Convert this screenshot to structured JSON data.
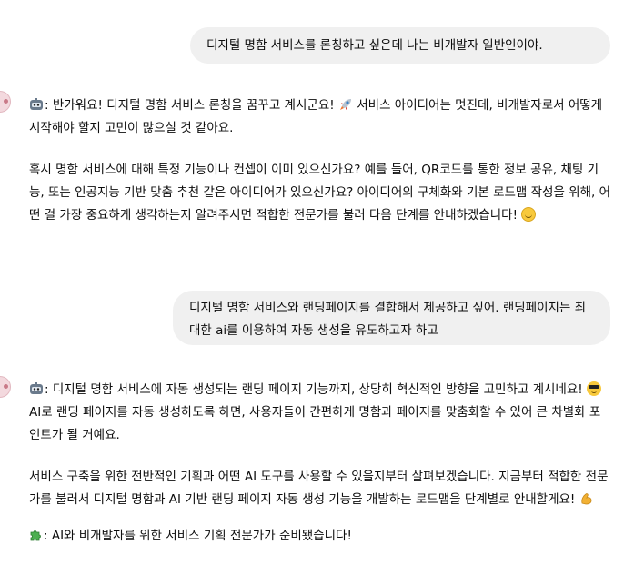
{
  "conversation": {
    "user_message_1": "디지털 명함 서비스를 론칭하고 싶은데 나는 비개발자 일반인이야.",
    "assistant_message_1": {
      "para1_prefix": ": 반가워요! 디지털 명함 서비스 론칭을 꿈꾸고 계시군요! ",
      "para1_suffix": " 서비스 아이디어는 멋진데, 비개발자로서 어떻게 시작해야 할지 고민이 많으실 것 같아요.",
      "para2": "혹시 명함 서비스에 대해 특정 기능이나 컨셉이 이미 있으신가요? 예를 들어, QR코드를 통한 정보 공유, 채팅 기능, 또는 인공지능 기반 맞춤 추천 같은 아이디어가 있으신가요? 아이디어의 구체화와 기본 로드맵 작성을 위해, 어떤 걸 가장 중요하게 생각하는지 알려주시면 적합한 전문가를 불러 다음 단계를 안내하겠습니다! "
    },
    "user_message_2": "디지털 명함 서비스와 랜딩페이지를 결합해서 제공하고 싶어. 랜딩페이지는 최대한 ai를 이용하여 자동 생성을 유도하고자 하고",
    "assistant_message_2": {
      "para1_prefix": ": 디지털 명함 서비스에 자동 생성되는 랜딩 페이지 기능까지, 상당히 혁신적인 방향을 고민하고 계시네요! ",
      "para1_suffix": " AI로 랜딩 페이지를 자동 생성하도록 하면, 사용자들이 간편하게 명함과 페이지를 맞춤화할 수 있어 큰 차별화 포인트가 될 거예요.",
      "para2": "서비스 구축을 위한 전반적인 기획과 어떤 AI 도구를 사용할 수 있을지부터 살펴보겠습니다. 지금부터 적합한 전문가를 불러서 디지털 명함과 AI 기반 랜딩 페이지 자동 생성 기능을 개발하는 로드맵을 단계별로 안내할게요! ",
      "para3": ": AI와 비개발자를 위한 서비스 기획 전문가가 준비됐습니다!"
    }
  },
  "icons": {
    "bot": "bot-face-icon",
    "rocket": "rocket-icon",
    "smile": "smiling-face-icon",
    "cool": "sunglasses-face-icon",
    "muscle": "flexed-biceps-icon",
    "puzzle": "puzzle-piece-icon"
  },
  "colors": {
    "user_bubble": "#f0f0f0",
    "text": "#0d0d0d",
    "background": "#ffffff"
  }
}
